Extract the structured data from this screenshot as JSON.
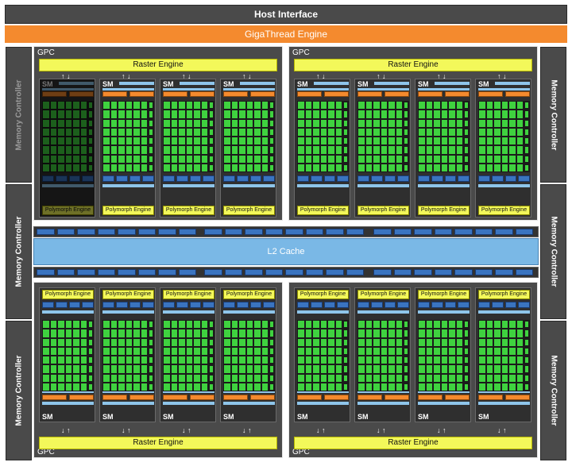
{
  "host_interface": {
    "label": "Host Interface"
  },
  "gigathread_engine": {
    "label": "GigaThread Engine"
  },
  "memory_controller": {
    "label": "Memory Controller"
  },
  "l2_cache": {
    "label": "L2 Cache"
  },
  "gpc": {
    "label": "GPC",
    "raster_label": "Raster Engine",
    "sm_label": "SM",
    "polymorph_label": "Polymorph Engine"
  },
  "colors": {
    "background": "#ffffff",
    "panel": "#4a4a4a",
    "gigathread": "#f48a2e",
    "core": "#3fd23f",
    "raster": "#f3f85a",
    "l2": "#7ab8e6",
    "load_store": "#3a74c0"
  },
  "state": {
    "disabled_sm": "top-left GPC, first SM (dimmed)"
  }
}
